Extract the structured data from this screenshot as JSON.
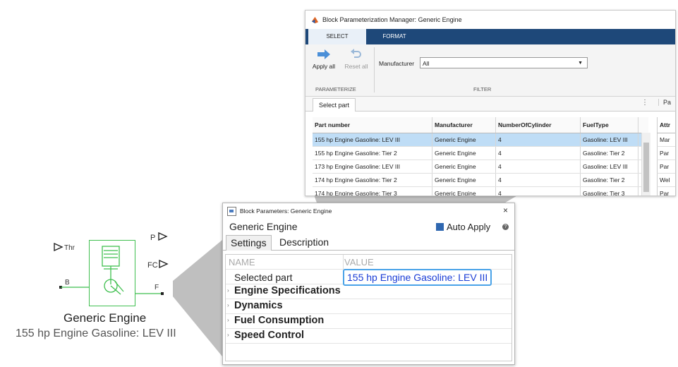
{
  "engine_block": {
    "ports": {
      "thr": "Thr",
      "p": "P",
      "fc": "FC",
      "b": "B",
      "f": "F"
    },
    "name": "Generic Engine",
    "part": "155 hp Engine Gasoline: LEV III",
    "colors": {
      "outline": "#3fbf4f"
    }
  },
  "bpm": {
    "title": "Block Parameterization Manager: Generic Engine",
    "tabs": {
      "select": "SELECT",
      "format": "FORMAT"
    },
    "toolstrip": {
      "apply_all": "Apply all",
      "reset_all": "Reset all",
      "section_parameterize": "PARAMETERIZE",
      "section_filter": "FILTER",
      "manufacturer_label": "Manufacturer",
      "manufacturer_value": "All"
    },
    "subtab": "Select part",
    "side_tab": "Pa",
    "table": {
      "headers": [
        "Part number",
        "Manufacturer",
        "NumberOfCylinder",
        "FuelType"
      ],
      "rows": [
        [
          "155 hp Engine Gasoline: LEV III",
          "Generic Engine",
          "4",
          "Gasoline: LEV III"
        ],
        [
          "155 hp Engine Gasoline: Tier 2",
          "Generic Engine",
          "4",
          "Gasoline: Tier 2"
        ],
        [
          "173 hp Engine Gasoline: LEV III",
          "Generic Engine",
          "4",
          "Gasoline: LEV III"
        ],
        [
          "174 hp Engine Gasoline: Tier 2",
          "Generic Engine",
          "4",
          "Gasoline: Tier 2"
        ],
        [
          "174 hp Engine Gasoline: Tier 3",
          "Generic Engine",
          "4",
          "Gasoline: Tier 3"
        ]
      ],
      "selected_row": 0
    },
    "attr_column": {
      "header": "Attr",
      "rows": [
        "Mar",
        "Par",
        "Par",
        "Wel",
        "Par"
      ]
    },
    "colors": {
      "tabbar": "#1e4879",
      "selected_row": "#bfddf6"
    }
  },
  "block_params": {
    "title": "Block Parameters: Generic Engine",
    "close": "×",
    "name": "Generic Engine",
    "auto_apply": "Auto Apply",
    "help": "?",
    "tabs": {
      "settings": "Settings",
      "description": "Description"
    },
    "columns": {
      "name": "NAME",
      "value": "VALUE"
    },
    "selected_part_label": "Selected part",
    "selected_part_value": "155 hp Engine Gasoline: LEV III",
    "groups": [
      "Engine Specifications",
      "Dynamics",
      "Fuel Consumption",
      "Speed Control"
    ]
  }
}
